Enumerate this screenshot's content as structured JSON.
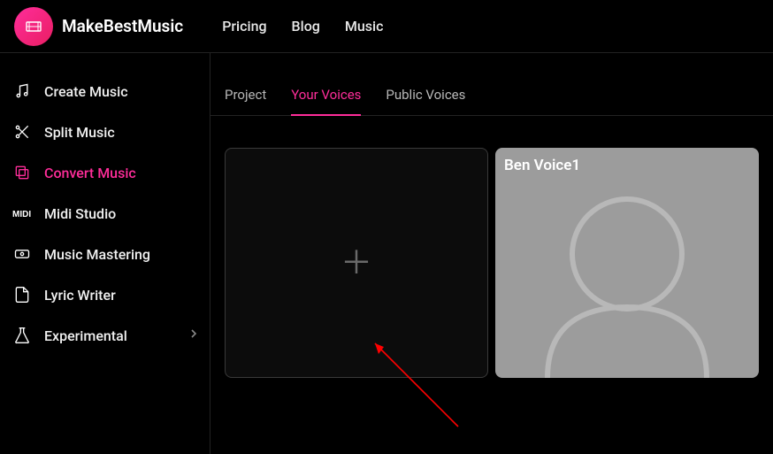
{
  "accent": "#ff2d9a",
  "brand": "MakeBestMusic",
  "nav": [
    {
      "label": "Pricing"
    },
    {
      "label": "Blog"
    },
    {
      "label": "Music"
    }
  ],
  "sidebar": [
    {
      "label": "Create Music",
      "icon": "music-note-icon"
    },
    {
      "label": "Split Music",
      "icon": "split-icon"
    },
    {
      "label": "Convert Music",
      "icon": "convert-icon",
      "active": true
    },
    {
      "label": "Midi Studio",
      "icon": "midi-icon"
    },
    {
      "label": "Music Mastering",
      "icon": "mastering-icon"
    },
    {
      "label": "Lyric Writer",
      "icon": "lyric-icon"
    },
    {
      "label": "Experimental",
      "icon": "flask-icon",
      "chevron": true
    }
  ],
  "tabs": [
    {
      "label": "Project"
    },
    {
      "label": "Your Voices",
      "active": true
    },
    {
      "label": "Public Voices"
    }
  ],
  "voice_card": {
    "title": "Ben Voice1"
  }
}
